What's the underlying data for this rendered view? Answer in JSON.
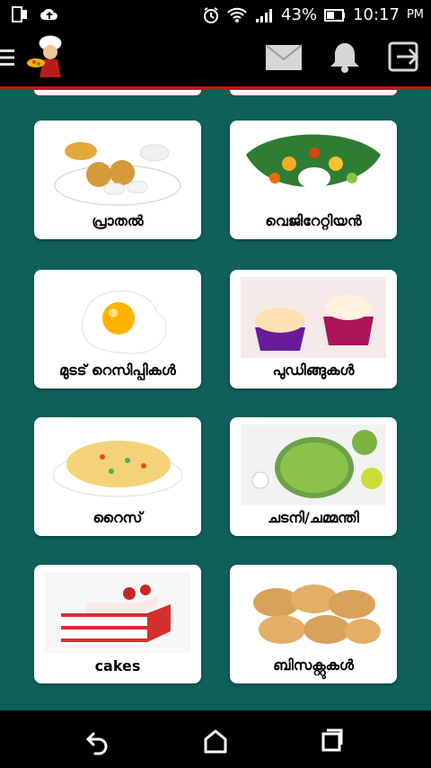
{
  "status_bar": {
    "battery_percent": "43%",
    "time": "10:17",
    "ampm": "PM"
  },
  "topbar": {
    "menu_icon": "hamburger-icon",
    "logo_icon": "chef-logo",
    "actions": [
      "mail-icon",
      "bell-icon",
      "logout-icon"
    ]
  },
  "categories": [
    {
      "label": "പ്രാതൽ",
      "icon": "breakfast-food-image"
    },
    {
      "label": "വെജിറേറ്റിയൻ",
      "icon": "vegetarian-meal-image"
    },
    {
      "label": "മുടട് റെസിപ്പികൾ",
      "icon": "fried-egg-image"
    },
    {
      "label": "പുഡിങ്ങുകൾ",
      "icon": "pudding-dessert-image"
    },
    {
      "label": "റൈസ്",
      "icon": "rice-dish-image"
    },
    {
      "label": "ചടനി/ചമ്മന്തി",
      "icon": "green-chutney-image"
    },
    {
      "label": "cakes",
      "icon": "layer-cake-image"
    },
    {
      "label": "ബിസക്റ്റുകൾ",
      "icon": "cookies-image"
    }
  ],
  "colors": {
    "background": "#0f5f5a",
    "topbar": "#000000",
    "accent_red": "#c4141c",
    "card": "#ffffff"
  },
  "navbar": {
    "buttons": [
      "back-icon",
      "home-icon",
      "recent-apps-icon"
    ]
  }
}
